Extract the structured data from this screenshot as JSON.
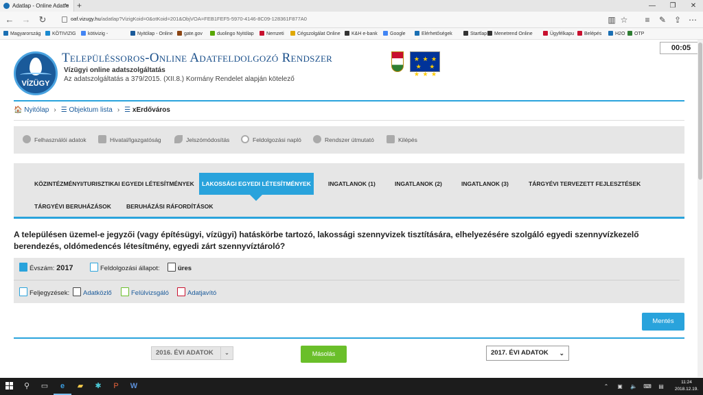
{
  "browser": {
    "tab_title": "Adatlap - Online Adatfe",
    "tab_close": "×",
    "new_tab": "+",
    "url_domain": "oaf.vizugy.hu",
    "url_path": "/adatlap?VizigKoid=0&otKoid=201&ObjVOA=FEB1FEF5-5970-4146-8C09-128361F877A0",
    "window_controls": [
      "—",
      "❐",
      "✕"
    ],
    "bookmarks": [
      {
        "label": "Magyarország",
        "color": "#1a6fb3"
      },
      {
        "label": "KÖTIVIZIG",
        "color": "#1a8ad0"
      },
      {
        "label": "kötivizig -",
        "color": "#4285f4"
      },
      {
        "label": "Nyitólap - Online",
        "color": "#1a5a9a"
      },
      {
        "label": "gate.gov",
        "color": "#8b4513"
      },
      {
        "label": "duolingo Nyitólap",
        "color": "#58a700"
      },
      {
        "label": "Nemzeti",
        "color": "#c8102e"
      },
      {
        "label": "Cégszolgálat Online",
        "color": "#e0a800"
      },
      {
        "label": "K&H e-bank",
        "color": "#333"
      },
      {
        "label": "Google",
        "color": "#4285f4"
      },
      {
        "label": "Elérhetőségek",
        "color": "#1a6fb3"
      },
      {
        "label": "Startlap -",
        "color": "#333"
      },
      {
        "label": "Menetrend Online",
        "color": "#333"
      },
      {
        "label": "Ügyfélkapu",
        "color": "#c8102e"
      },
      {
        "label": "Belépés",
        "color": "#c8102e"
      },
      {
        "label": "H2O",
        "color": "#1a6fb3"
      },
      {
        "label": "OTP",
        "color": "#2e7d32"
      }
    ]
  },
  "timer": "00:05",
  "header": {
    "logo_text": "VÍZÜGY",
    "title": "Településsoros-Online Adatfeldolgozó Rendszer",
    "subtitle": "Vízügyi online adatszolgáltatás",
    "legal_note": "Az adatszolgáltatás a 379/2015. (XII.8.) Kormány Rendelet alapján kötelező"
  },
  "breadcrumb": {
    "home": "Nyitólap",
    "list": "Objektum lista",
    "current": "xErdőváros"
  },
  "user_menu": [
    "Felhasználói adatok",
    "Hivatal/Igazgatóság",
    "Jelszómódosítás",
    "Feldolgozási napló",
    "Rendszer útmutató",
    "Kilépés"
  ],
  "tabs": {
    "row1": [
      "KÖZINTÉZMÉNYI/TURISZTIKAI EGYEDI LÉTESÍTMÉNYEK",
      "LAKOSSÁGI EGYEDI LÉTESÍTMÉNYEK",
      "INGATLANOK (1)",
      "INGATLANOK (2)",
      "INGATLANOK (3)",
      "TÁRGYÉVI TERVEZETT FEJLESZTÉSEK"
    ],
    "row2": [
      "TÁRGYÉVI BERUHÁZÁSOK",
      "BERUHÁZÁSI RÁFORDÍTÁSOK"
    ],
    "active_index": 1
  },
  "question": "A településen üzemel-e jegyzői (vagy építésügyi, vízügyi) hatáskörbe tartozó, lakossági szennyvizek tisztítására, elhelyezésére szolgáló egyedi szennyvízkezelő berendezés, oldómedencés létesítmény, egyedi zárt szennyvíztároló?",
  "info": {
    "year_label": "Évszám:",
    "year_value": "2017",
    "status_label": "Feldolgozási állapot:",
    "status_value": "üres",
    "notes_label": "Feljegyzések:",
    "notes": [
      "Adatközlő",
      "Felülvizsgáló",
      "Adatjavító"
    ]
  },
  "actions": {
    "save": "Mentés",
    "copy": "Másolás",
    "prev_year": "2016. ÉVI ADATOK",
    "curr_year": "2017. ÉVI ADATOK"
  },
  "colors": {
    "accent": "#29a3dc",
    "copy_button": "#6abf2a",
    "title_blue": "#1a4f8a",
    "panel_gray": "#e6e6e6"
  },
  "taskbar": {
    "time": "11:24",
    "date": "2018.12.19."
  }
}
